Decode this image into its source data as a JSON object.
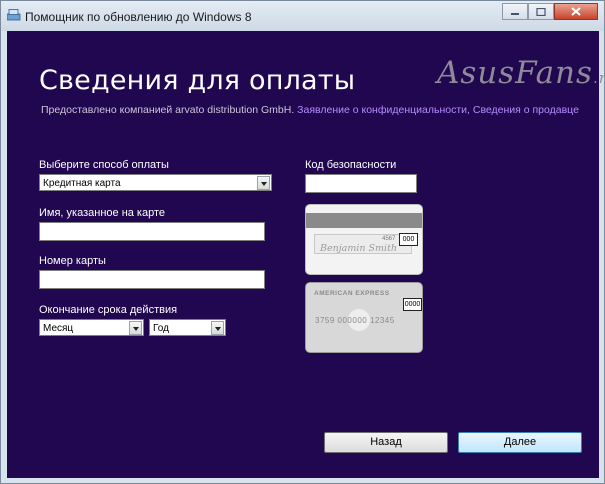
{
  "window": {
    "title": "Помощник по обновлению до Windows 8",
    "icons": [
      "app-icon",
      "minimize-icon",
      "maximize-icon",
      "close-icon"
    ]
  },
  "watermark": {
    "main": "AsusFans",
    "suffix": ".ru"
  },
  "page": {
    "heading": "Сведения для оплаты",
    "provider_text": "Предоставлено компанией arvato distribution GmbH.",
    "links": {
      "privacy": "Заявление о конфиденциальности",
      "separator": ", ",
      "seller": "Сведения о продавце"
    }
  },
  "form": {
    "payment_method": {
      "label": "Выберите способ оплаты",
      "value": "Кредитная карта"
    },
    "cardholder_name": {
      "label": "Имя, указанное на карте",
      "value": ""
    },
    "card_number": {
      "label": "Номер карты",
      "value": ""
    },
    "expiry": {
      "label": "Окончание срока действия",
      "month": "Месяц",
      "year": "Год"
    },
    "security_code": {
      "label": "Код безопасности",
      "value": ""
    }
  },
  "card_images": {
    "back": {
      "number_fragment": "4567",
      "cvv": "000",
      "signature": "Benjamin Smith"
    },
    "front": {
      "brand": "AMERICAN EXPRESS",
      "cvv": "0000",
      "number": "3759 000000 12345"
    }
  },
  "buttons": {
    "back": "Назад",
    "next": "Далее"
  },
  "colors": {
    "background": "#21074f",
    "link": "#b58cff",
    "primary_button": "#bee6fd"
  }
}
